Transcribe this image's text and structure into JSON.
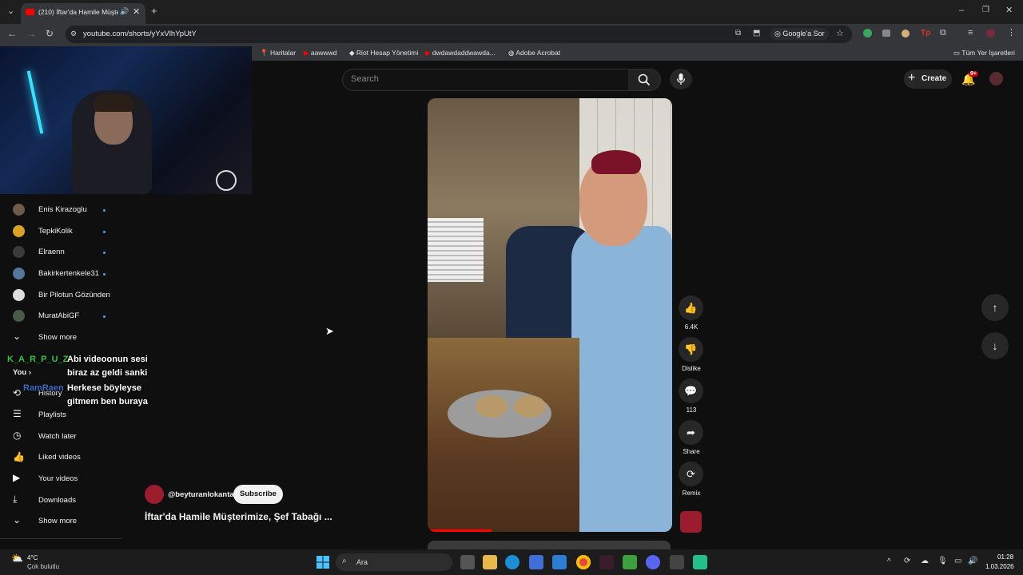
{
  "browser": {
    "tab_title": "(210) İftar'da Hamile Müşte",
    "url": "youtube.com/shorts/yYxVlhYpUtY",
    "ask_google": "Google'a Sor",
    "all_bookmarks": "Tüm Yer İşaretleri",
    "bookmarks": [
      "Haritalar",
      "aawwwd",
      "Riot Hesap Yönetimi",
      "dwdawdaddwawda...",
      "Adobe Acrobat"
    ]
  },
  "youtube": {
    "search_placeholder": "Search",
    "create_label": "Create",
    "notif_badge": "9+",
    "subscriptions": [
      {
        "name": "Enis Kirazoglu",
        "color": "#6d5c4a"
      },
      {
        "name": "TepkiKolik",
        "color": "#d9a227"
      },
      {
        "name": "Elraenn",
        "color": "#3a3a3a"
      },
      {
        "name": "Bakirkertenkele31",
        "color": "#557799"
      },
      {
        "name": "Bir Pilotun Gözünden",
        "color": "#ddd"
      },
      {
        "name": "MuratAbiGF",
        "color": "#4a5a4a"
      }
    ],
    "show_more": "Show more",
    "you_label": "You",
    "history_label": "History",
    "you_items": [
      "Playlists",
      "Watch later",
      "Liked videos",
      "Your videos",
      "Downloads"
    ],
    "show_more_2": "Show more",
    "actions": {
      "likes": "6.4K",
      "dislike": "Dislike",
      "comments": "113",
      "share": "Share",
      "remix": "Remix"
    },
    "channel_handle": "@beyturanlokanta",
    "subscribe_label": "Subscribe",
    "video_title": "İftar'da Hamile Müşterimize, Şef Tabağı ..."
  },
  "overlay_chat": {
    "user1": "K_A_R_P_U_Z",
    "msg1_lines": [
      "Abi videoonun sesi",
      "biraz az geldi sanki"
    ],
    "user2": "RamRaen",
    "msg2_lines": [
      "Herkese böyleyse",
      "gitmem ben buraya"
    ]
  },
  "taskbar": {
    "weather_temp": "4°C",
    "weather_desc": "Çok bulutlu",
    "search_label": "Ara",
    "time": "01:28",
    "date": "1.03.2026"
  },
  "colors": {
    "accent": "#3ea6ff",
    "youtube_red": "#ff0000",
    "chat_user1": "#2ecc40",
    "chat_user2": "#3a6cc8"
  }
}
